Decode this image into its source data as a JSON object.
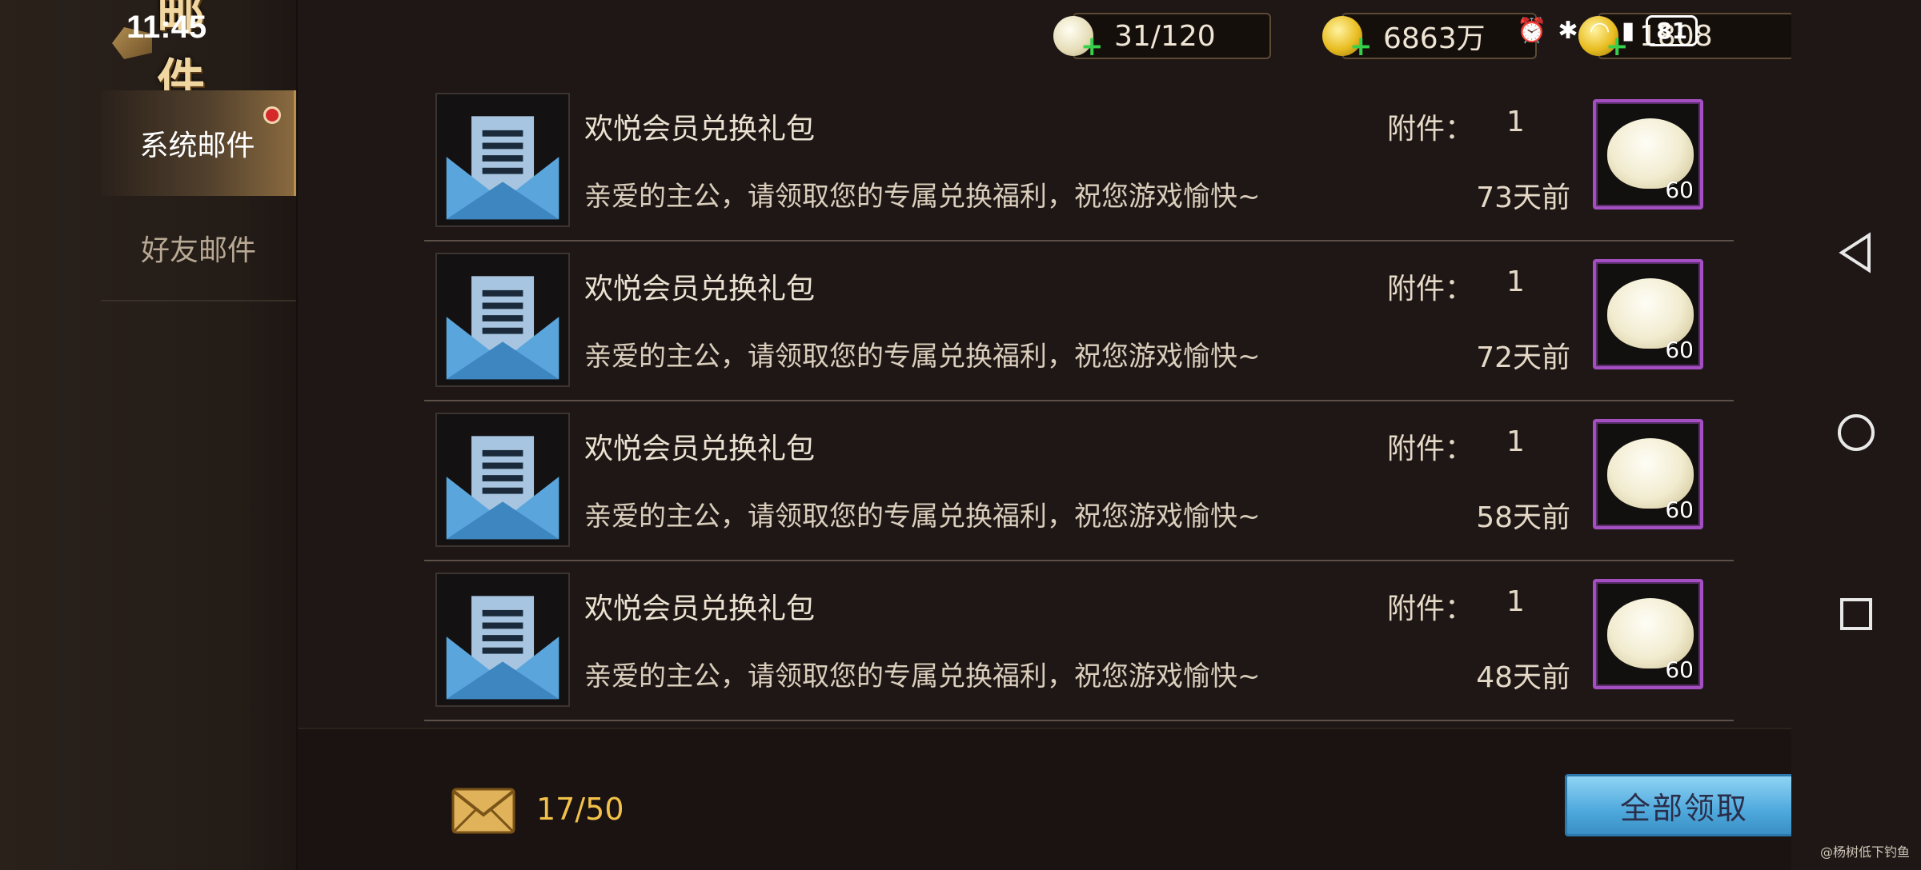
{
  "status_bar": {
    "time": "11:45",
    "battery": "81"
  },
  "header": {
    "title": "邮 件"
  },
  "resources": [
    {
      "icon": "steamed-bun-icon",
      "value": "31/120"
    },
    {
      "icon": "gold-coin-icon",
      "value": "6863万"
    },
    {
      "icon": "ingot-icon",
      "value": "1808"
    }
  ],
  "sidebar": {
    "tabs": [
      {
        "label": "系统邮件",
        "active": true,
        "has_notification": true
      },
      {
        "label": "好友邮件",
        "active": false,
        "has_notification": false
      }
    ]
  },
  "mails": [
    {
      "title": "欢悦会员兑换礼包",
      "body": "亲爱的主公，请领取您的专属兑换福利，祝您游戏愉快~",
      "attachment_label": "附件：",
      "attachment_count": "1",
      "age": "73天前",
      "reward_icon": "steamed-bun-icon",
      "reward_qty": "60"
    },
    {
      "title": "欢悦会员兑换礼包",
      "body": "亲爱的主公，请领取您的专属兑换福利，祝您游戏愉快~",
      "attachment_label": "附件：",
      "attachment_count": "1",
      "age": "72天前",
      "reward_icon": "steamed-bun-icon",
      "reward_qty": "60"
    },
    {
      "title": "欢悦会员兑换礼包",
      "body": "亲爱的主公，请领取您的专属兑换福利，祝您游戏愉快~",
      "attachment_label": "附件：",
      "attachment_count": "1",
      "age": "58天前",
      "reward_icon": "steamed-bun-icon",
      "reward_qty": "60"
    },
    {
      "title": "欢悦会员兑换礼包",
      "body": "亲爱的主公，请领取您的专属兑换福利，祝您游戏愉快~",
      "attachment_label": "附件：",
      "attachment_count": "1",
      "age": "48天前",
      "reward_icon": "steamed-bun-icon",
      "reward_qty": "60"
    }
  ],
  "footer": {
    "mail_count": "17/50",
    "claim_all_label": "全部领取"
  },
  "watermark": "@杨树低下钓鱼",
  "colors": {
    "reward_border": "#a34fc1",
    "claim_button": "#4ea9dc",
    "count_text": "#f2c14b",
    "notification_dot": "#d42a2a"
  }
}
